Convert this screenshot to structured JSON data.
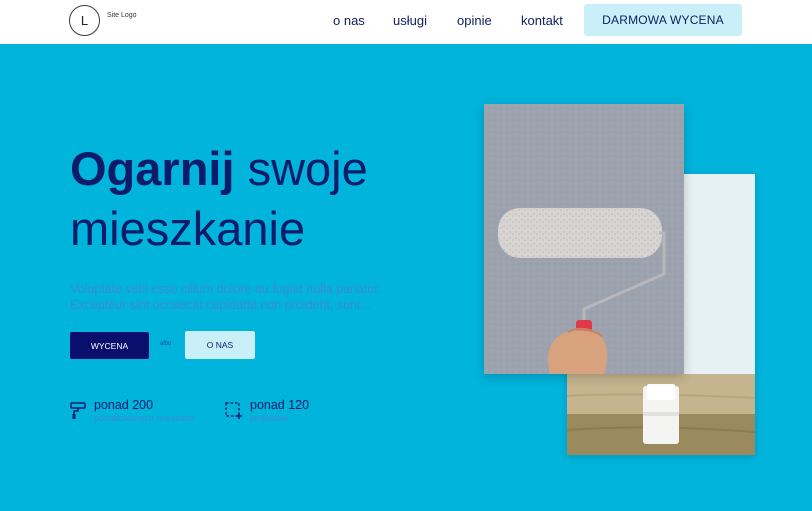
{
  "header": {
    "logo_letter": "L",
    "logo_text": "Site Logo",
    "nav": [
      {
        "label": "o nas"
      },
      {
        "label": "usługi"
      },
      {
        "label": "opinie"
      },
      {
        "label": "kontakt"
      }
    ],
    "cta_label": "DARMOWA WYCENA"
  },
  "hero": {
    "title_bold": "Ogarnij",
    "title_rest": " swoje mieszkanie",
    "lead": "Voluptate velit esse cillum dolore eu fugiat nulla pariatur. Excepteur sint occaecat cupidatat non proident, sunt...",
    "primary_button": "WYCENA",
    "albo": "albo",
    "secondary_button": "O NAS",
    "stats": [
      {
        "number": "ponad 200",
        "label": "pomalowanych mieszkoń",
        "icon": "paint-roller-icon"
      },
      {
        "number": "ponad 120",
        "label": "projektów",
        "icon": "selection-add-icon"
      }
    ]
  },
  "colors": {
    "hero_bg": "#00b4dc",
    "navy": "#0d1b6b",
    "light_cyan": "#c9eff8"
  }
}
